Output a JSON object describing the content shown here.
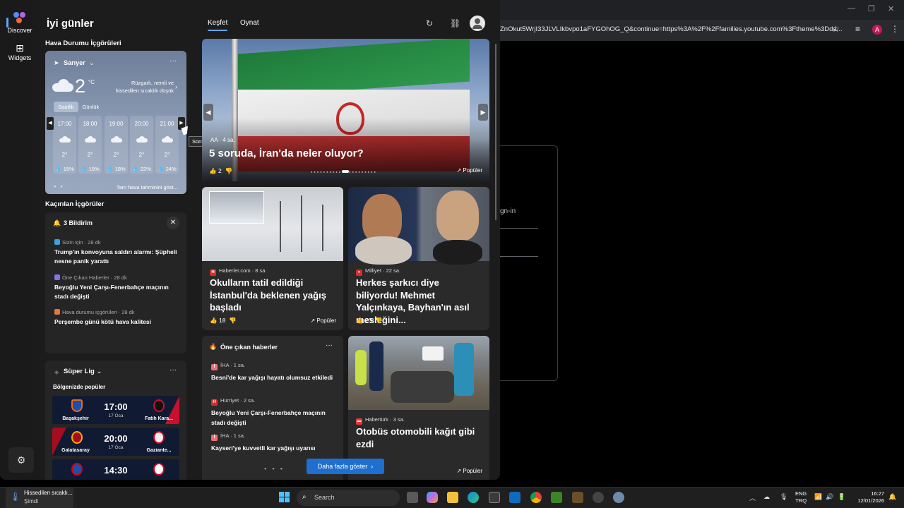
{
  "browser": {
    "url": "ZnOkut5WrjI33JLVLIkbvpo1aFYGOhOG_Q&continue=https%3A%2F%2Ffamilies.youtube.com%3Ftheme%3Dda...",
    "profile_initial": "A",
    "signin_text": "gn-in"
  },
  "rail": {
    "discover_label": "Discover",
    "widgets_label": "Widgets"
  },
  "header": {
    "greeting": "İyi günler",
    "tabs": [
      "Keşfet",
      "Oynat"
    ]
  },
  "weather": {
    "section_title": "Hava Durumu İçgörüleri",
    "location": "Sarıyer",
    "temperature": "2",
    "unit": "°C",
    "description": "Rüzgarlı, nemli ve hissedilen sıcaklık düşük",
    "toggle": [
      "Saatlik",
      "Günlük"
    ],
    "hours": [
      {
        "time": "17:00",
        "temp": "2°",
        "precip": "15%"
      },
      {
        "time": "18:00",
        "temp": "2°",
        "precip": "19%"
      },
      {
        "time": "19:00",
        "temp": "2°",
        "precip": "18%"
      },
      {
        "time": "20:00",
        "temp": "2°",
        "precip": "22%"
      },
      {
        "time": "21:00",
        "temp": "2°",
        "precip": "24%"
      }
    ],
    "forecast_link": "Tam hava tahminini göst...",
    "tooltip": "Sonraki"
  },
  "missed": {
    "section_title": "Kaçırılan İçgörüler",
    "heading": "3 Bildirim",
    "items": [
      {
        "source": "Sizin için · 28 dk",
        "title": "Trump'ın konvoyuna saldırı alarmı: Şüpheli nesne panik yarattı",
        "color": "#3aa0e8"
      },
      {
        "source": "Öne Çıkan Haberler · 28 dk",
        "title": "Beyoğlu Yeni Çarşı-Fenerbahçe maçının stadı değişti",
        "color": "#8a6de9"
      },
      {
        "source": "Hava durumu içgörüleri · 28 dk",
        "title": "Perşembe günü kötü hava kalitesi",
        "color": "#e07a3a"
      }
    ]
  },
  "league": {
    "title": "Süper Lig",
    "subtitle": "Bölgenizde popüler",
    "matches": [
      {
        "home": "Başakşehir",
        "away": "Fatih Kara...",
        "time": "17:00",
        "date": "17 Oca",
        "home_color": "#e86a1c",
        "away_color": "#c8102e"
      },
      {
        "home": "Galatasaray",
        "away": "Gaziante...",
        "time": "20:00",
        "date": "17 Oca",
        "home_color": "#f5a800",
        "away_color": "#d0021b"
      },
      {
        "home": "",
        "away": "",
        "time": "14:30",
        "date": "",
        "home_color": "#1f4fa8",
        "away_color": "#d0021b"
      }
    ]
  },
  "hero": {
    "source": "AA · 4 sa.",
    "title": "5 soruda, İran'da neler oluyor?",
    "likes": "2",
    "tag": "Popüler"
  },
  "cards": [
    {
      "source": "Haberler.com · 8 sa.",
      "title": "Okulların tatil edildiği İstanbul'da beklenen yağış başladı",
      "likes": "18",
      "tag": "Popüler",
      "icon": "H",
      "icon_color": "#d32f2f"
    },
    {
      "source": "Milliyet · 22 sa.",
      "title": "Herkes şarkıcı diye biliyordu! Mehmet Yalçınkaya, Bayhan'ın asıl mesleğini...",
      "likes": "23",
      "tag": "",
      "icon": "»",
      "icon_color": "#d32f2f"
    },
    {
      "source": "Habertürk · 3 sa.",
      "title": "Otobüs otomobili kağıt gibi ezdi",
      "likes": "",
      "tag": "Popüler",
      "icon": "▬",
      "icon_color": "#e53935"
    }
  ],
  "top_news": {
    "heading": "Öne çıkan haberler",
    "items": [
      {
        "source": "İHA · 1 sa.",
        "title": "Besni'de kar yağışı hayatı olumsuz etkiledi",
        "icon": "İ",
        "icon_color": "#e57373"
      },
      {
        "source": "Hürriyet · 2 sa.",
        "title": "Beyoğlu Yeni Çarşı-Fenerbahçe maçının stadı değişti",
        "icon": "H",
        "icon_color": "#d32f2f"
      },
      {
        "source": "İHA · 1 sa.",
        "title": "Kayseri'ye kuvvetli kar yağışı uyarısı",
        "icon": "İ",
        "icon_color": "#e57373"
      }
    ]
  },
  "more_button": "Daha fazla göster",
  "taskbar": {
    "weather_line1": "Hissedilen sıcaklı...",
    "weather_line2": "Şimdi",
    "search": "Search",
    "lang1": "ENG",
    "lang2": "TRQ",
    "time": "16:27",
    "date": "12/01/2026"
  }
}
